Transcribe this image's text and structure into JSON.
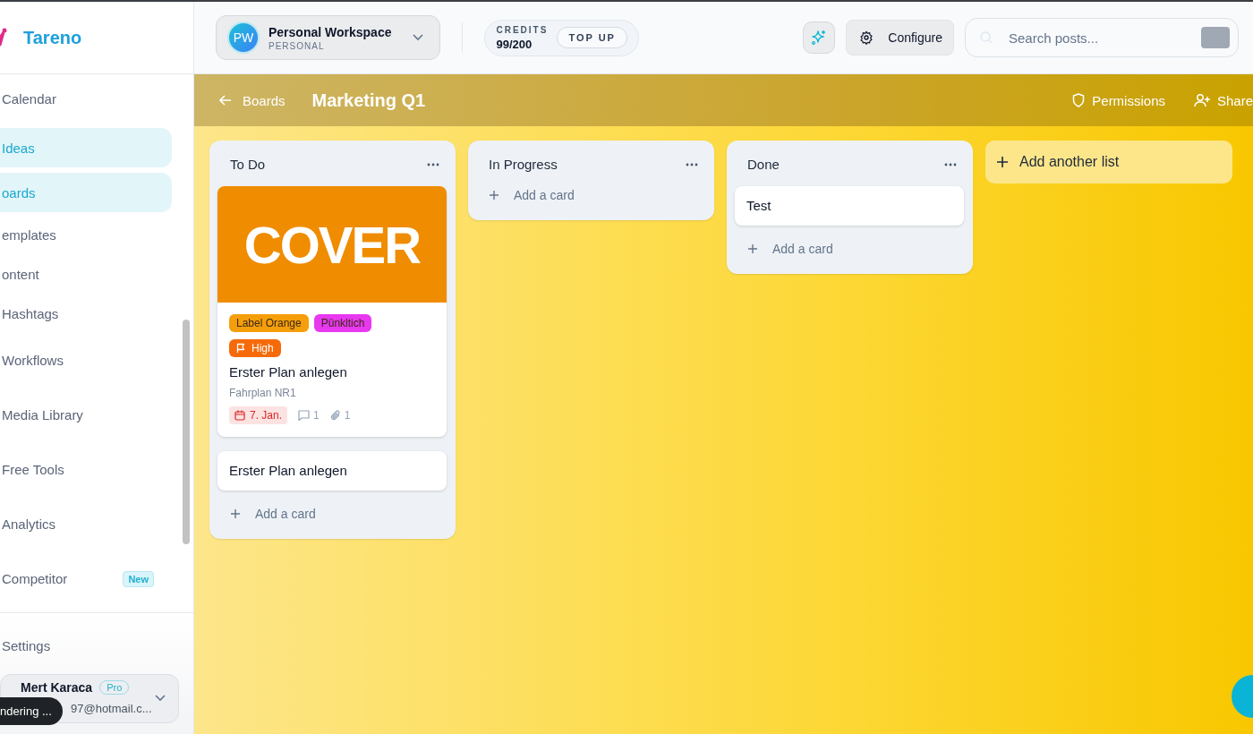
{
  "brand": {
    "name": "Tareno"
  },
  "sidebar": {
    "items": [
      {
        "label": "Calendar",
        "selected": false
      },
      {
        "label": "Ideas",
        "selected": true
      },
      {
        "label": "oards",
        "selected": true
      },
      {
        "label": "emplates",
        "selected": false
      },
      {
        "label": "ontent",
        "selected": false
      },
      {
        "label": "Hashtags",
        "selected": false
      },
      {
        "label": "Workflows",
        "selected": false
      },
      {
        "label": "Media Library",
        "selected": false
      },
      {
        "label": "Free Tools",
        "selected": false
      },
      {
        "label": "Analytics",
        "selected": false
      },
      {
        "label": "Competitor",
        "selected": false,
        "badge": "New"
      }
    ],
    "settings": "Settings",
    "user": {
      "name": "Mert Karaca",
      "plan": "Pro",
      "email": "97@hotmail.c..."
    },
    "toast": "ndering ..."
  },
  "topbar": {
    "workspace": {
      "initials": "PW",
      "name": "Personal Workspace",
      "type": "PERSONAL"
    },
    "credits": {
      "label": "CREDITS",
      "value": "99/200",
      "action": "TOP UP"
    },
    "configure": "Configure",
    "search": {
      "placeholder": "Search posts..."
    }
  },
  "board": {
    "back": "Boards",
    "title": "Marketing Q1",
    "actions": [
      "Permissions",
      "Share"
    ],
    "lists": [
      {
        "title": "To Do",
        "add": "Add a card",
        "cards": [
          {
            "cover": "COVER",
            "labels": [
              {
                "text": "Label Orange",
                "color": "#f59e0b"
              },
              {
                "text": "Pünkltich",
                "color": "#e838f0"
              }
            ],
            "priority": "High",
            "title": "Erster Plan anlegen",
            "subtitle": "Fahrplan NR1",
            "due": "7. Jan.",
            "comments": "1",
            "attachments": "1"
          },
          {
            "title": "Erster Plan anlegen"
          }
        ]
      },
      {
        "title": "In Progress",
        "add": "Add a card"
      },
      {
        "title": "Done",
        "add": "Add a card",
        "cards": [
          {
            "title": "Test"
          }
        ]
      }
    ],
    "add_list": "Add another list"
  }
}
